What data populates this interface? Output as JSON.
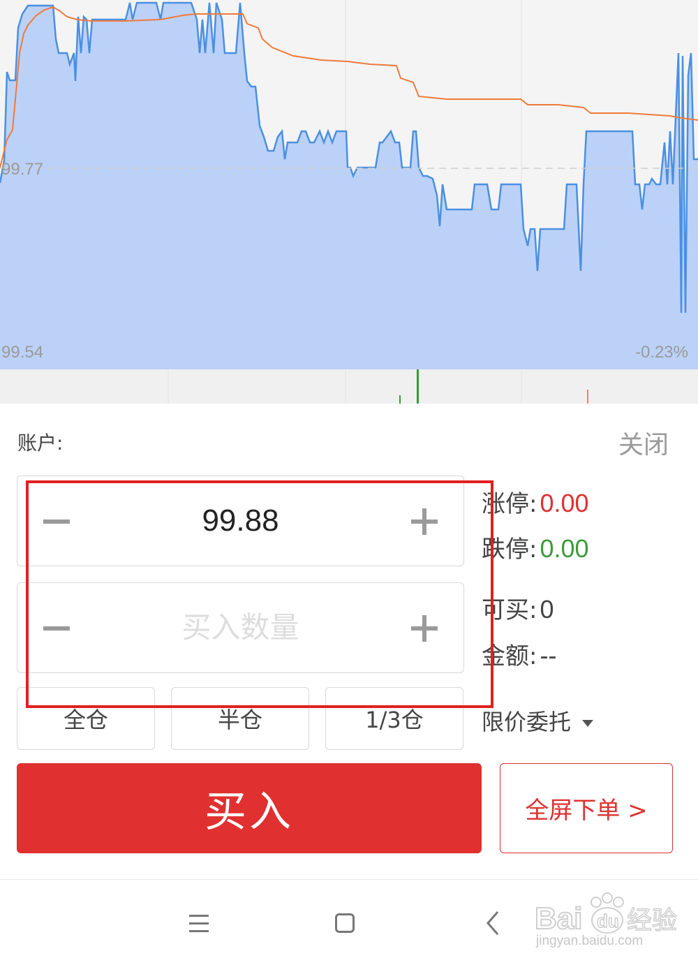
{
  "chart": {
    "price_ref_label": "99.77",
    "price_min_label": "99.54",
    "pct_min_label": "-0.23%",
    "colors": {
      "price_line": "#4a90e2",
      "price_fill": "#bcd1f7",
      "avg_line": "#f07a3a",
      "background": "#f4f4f4",
      "volume_up": "#e03030",
      "volume_down": "#2ca02c"
    }
  },
  "panel": {
    "account_label": "账户:",
    "close_label": "关闭",
    "price_value": "99.88",
    "qty_placeholder": "买入数量",
    "quick": {
      "full": "全仓",
      "half": "半仓",
      "third": "1/3仓"
    },
    "limit_up_label": "涨停:",
    "limit_up_value": "0.00",
    "limit_down_label": "跌停:",
    "limit_down_value": "0.00",
    "buyable_label": "可买:",
    "buyable_value": "0",
    "amount_label": "金额:",
    "amount_value": "--",
    "order_type": "限价委托",
    "buy_label": "买入",
    "fullscreen_label": "全屏下单 >",
    "colors": {
      "up": "#e03030",
      "down": "#3c9a3c",
      "buy_bg": "#e03030"
    }
  },
  "nav": {
    "icons": [
      "menu-icon",
      "home-icon",
      "back-icon"
    ]
  },
  "watermark": {
    "brand_text": "Bai",
    "brand_text2": "du",
    "brand_suffix": "经验",
    "url": "jingyan.baidu.com"
  }
}
